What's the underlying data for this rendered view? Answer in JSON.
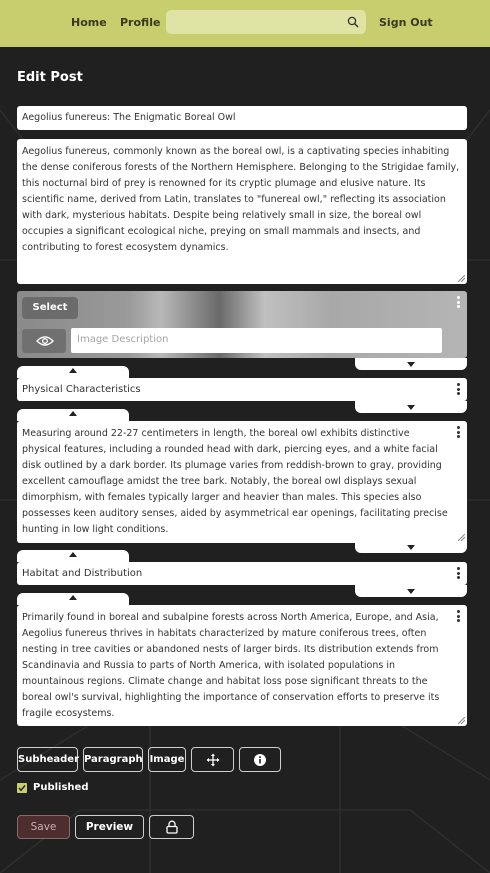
{
  "nav": {
    "home": "Home",
    "profile": "Profile",
    "search_value": "",
    "sign_out": "Sign Out"
  },
  "page_title": "Edit Post",
  "post": {
    "title": "Aegolius funereus: The Enigmatic Boreal Owl",
    "intro": "Aegolius funereus, commonly known as the boreal owl, is a captivating species inhabiting the dense coniferous forests of the Northern Hemisphere. Belonging to the Strigidae family, this nocturnal bird of prey is renowned for its cryptic plumage and elusive nature. Its scientific name, derived from Latin, translates to \"funereal owl,\" reflecting its association with dark, mysterious habitats. Despite being relatively small in size, the boreal owl occupies a significant ecological niche, preying on small mammals and insects, and contributing to forest ecosystem dynamics.",
    "image": {
      "select_label": "Select",
      "description_placeholder": "Image Description"
    },
    "subheader1": "Physical Characteristics",
    "paragraph2": "Measuring around 22-27 centimeters in length, the boreal owl exhibits distinctive physical features, including a rounded head with dark, piercing eyes, and a white facial disk outlined by a dark border. Its plumage varies from reddish-brown to gray, providing excellent camouflage amidst the tree bark. Notably, the boreal owl displays sexual dimorphism, with females typically larger and heavier than males. This species also possesses keen auditory senses, aided by asymmetrical ear openings, facilitating precise hunting in low light conditions.",
    "subheader2": "Habitat and Distribution",
    "paragraph3": "Primarily found in boreal and subalpine forests across North America, Europe, and Asia, Aegolius funereus thrives in habitats characterized by mature coniferous trees, often nesting in tree cavities or abandoned nests of larger birds. Its distribution extends from Scandinavia and Russia to parts of North America, with isolated populations in mountainous regions. Climate change and habitat loss pose significant threats to the boreal owl's survival, highlighting the importance of conservation efforts to preserve its fragile ecosystems."
  },
  "toolbar": {
    "subheader": "Subheader",
    "paragraph": "Paragraph",
    "image": "Image",
    "move_icon": "move-icon",
    "info_icon": "info-icon"
  },
  "published_label": "Published",
  "published_checked": true,
  "actions": {
    "save": "Save",
    "preview": "Preview",
    "lock_icon": "lock-icon"
  },
  "colors": {
    "navbar": "#c8cd6e",
    "background": "#202020",
    "save_bg": "#4d2d2d"
  }
}
